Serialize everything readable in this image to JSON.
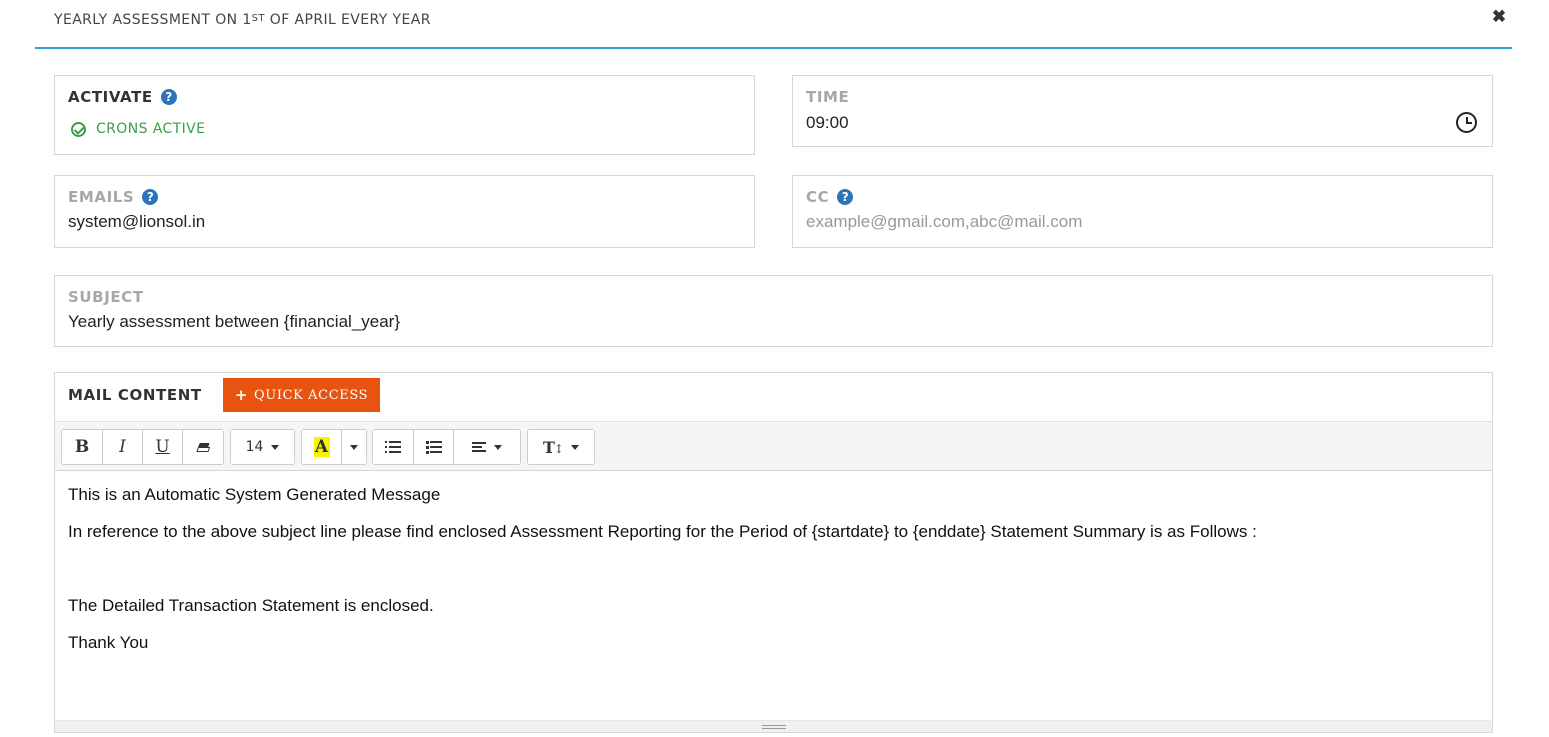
{
  "modal": {
    "title_prefix": "YEARLY ASSESSMENT ON 1",
    "title_sup": "ST",
    "title_suffix": " OF APRIL EVERY YEAR",
    "close_symbol": "✖"
  },
  "activate": {
    "label": "ACTIVATE",
    "help": "?",
    "status": "CRONS ACTIVE"
  },
  "time": {
    "label": "TIME",
    "value": "09:00"
  },
  "emails": {
    "label": "EMAILS",
    "help": "?",
    "value": "system@lionsol.in"
  },
  "cc": {
    "label": "CC",
    "help": "?",
    "value": "",
    "placeholder": "example@gmail.com,abc@mail.com"
  },
  "subject": {
    "label": "SUBJECT",
    "value": "Yearly assessment between {financial_year}"
  },
  "mail_content": {
    "label": "MAIL CONTENT",
    "quick_access_label": "QUICK ACCESS",
    "quick_access_icon": "+",
    "toolbar": {
      "bold": "B",
      "italic": "I",
      "underline": "U",
      "font_size": "14",
      "highlight": "A",
      "text_size": "T",
      "text_size_arrow": "↕"
    },
    "body": {
      "line1": "This is an Automatic System Generated Message",
      "line2": "In reference to the above subject line please find enclosed Assessment Reporting for the Period of {startdate} to {enddate} Statement Summary is as Follows :",
      "line3": "The Detailed Transaction Statement is enclosed.",
      "line4": "Thank You"
    }
  },
  "colors": {
    "accent_line": "#29a3d6",
    "help_icon": "#2d73b8",
    "status_green": "#3b9e4a",
    "quick_access": "#e8540f",
    "highlight_yellow": "#f5f500"
  }
}
